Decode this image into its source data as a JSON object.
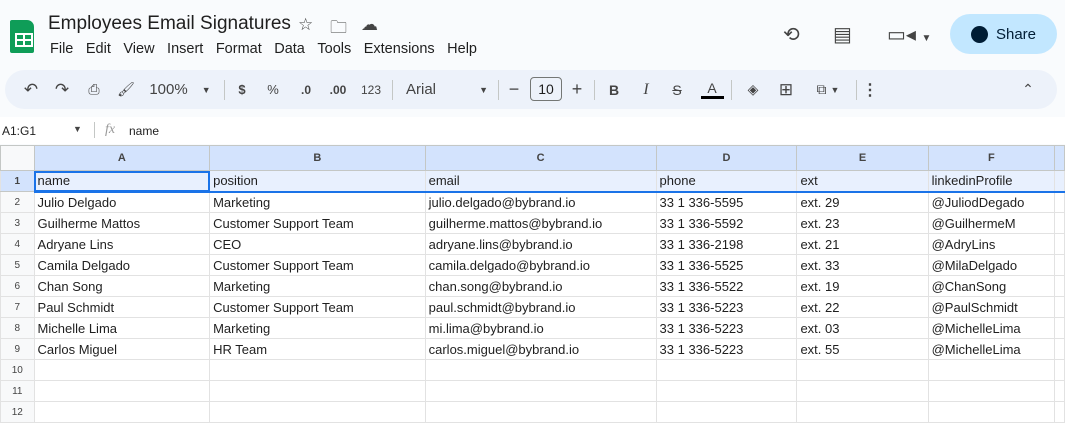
{
  "doc": {
    "title": "Employees Email Signatures"
  },
  "menu": [
    "File",
    "Edit",
    "View",
    "Insert",
    "Format",
    "Data",
    "Tools",
    "Extensions",
    "Help"
  ],
  "share_label": "Share",
  "toolbar": {
    "zoom": "100%",
    "currency": "$",
    "percent": "%",
    "dec_decrease": ".0",
    "dec_increase": ".00",
    "number_format": "123",
    "font": "Arial",
    "font_size": "10",
    "bold": "B",
    "italic": "I"
  },
  "formula_bar": {
    "name_box": "A1:G1",
    "fx": "fx",
    "value": "name"
  },
  "columns": [
    "A",
    "B",
    "C",
    "D",
    "E",
    "F"
  ],
  "rows": [
    [
      "name",
      "position",
      "email",
      "phone",
      "ext",
      "linkedinProfile"
    ],
    [
      "Julio Delgado",
      "Marketing",
      "julio.delgado@bybrand.io",
      "33 1 336-5595",
      "ext. 29",
      "@JuliodDegado"
    ],
    [
      "Guilherme Mattos",
      "Customer Support Team",
      "guilherme.mattos@bybrand.io",
      "33 1 336-5592",
      "ext. 23",
      "@GuilhermeM"
    ],
    [
      "Adryane Lins",
      "CEO",
      "adryane.lins@bybrand.io",
      "33 1 336-2198",
      "ext. 21",
      "@AdryLins"
    ],
    [
      "Camila Delgado",
      "Customer Support Team",
      "camila.delgado@bybrand.io",
      "33 1 336-5525",
      "ext. 33",
      "@MilaDelgado"
    ],
    [
      "Chan Song",
      "Marketing",
      "chan.song@bybrand.io",
      "33 1 336-5522",
      "ext. 19",
      "@ChanSong"
    ],
    [
      "Paul Schmidt",
      "Customer Support Team",
      "paul.schmidt@bybrand.io",
      "33 1 336-5223",
      "ext. 22",
      "@PaulSchmidt"
    ],
    [
      "Michelle Lima",
      "Marketing",
      "mi.lima@bybrand.io",
      "33 1 336-5223",
      "ext. 03",
      "@MichelleLima"
    ],
    [
      "Carlos Miguel",
      "HR Team",
      "carlos.miguel@bybrand.io",
      "33 1 336-5223",
      "ext. 55",
      "@MichelleLima"
    ],
    [
      "",
      "",
      "",
      "",
      "",
      ""
    ],
    [
      "",
      "",
      "",
      "",
      "",
      ""
    ],
    [
      "",
      "",
      "",
      "",
      "",
      ""
    ]
  ],
  "row_numbers": [
    "1",
    "2",
    "3",
    "4",
    "5",
    "6",
    "7",
    "8",
    "9",
    "10",
    "11",
    "12"
  ]
}
